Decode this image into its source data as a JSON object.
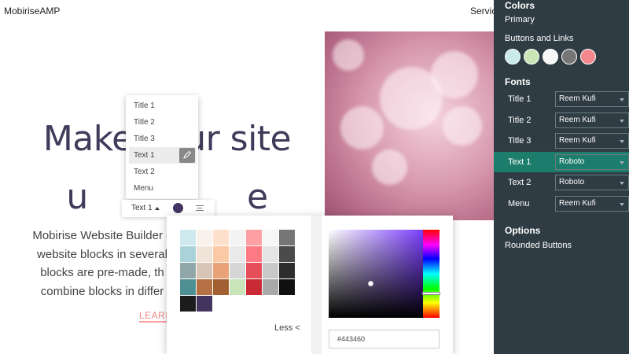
{
  "header": {
    "brand": "MobiriseAMP",
    "nav_partial": "Servic"
  },
  "hero": {
    "title_lines": [
      "Make your site",
      "u               e"
    ],
    "text_lines": [
      "Mobirise Website Builder c",
      "website blocks in several",
      "blocks are pre-made, th",
      "combine blocks in differ"
    ],
    "learn_button": "LEARN"
  },
  "style_menu": {
    "items": [
      "Title 1",
      "Title 2",
      "Title 3",
      "Text 1",
      "Text 2",
      "Menu"
    ],
    "active_index": 3
  },
  "text_toolbar": {
    "style_label": "Text 1",
    "color": "#443460"
  },
  "color_picker": {
    "swatches": [
      [
        "#cde9ee",
        "#f9f2ec",
        "#fde1cc",
        "#f4f4f4",
        "#ff9fa4",
        "#f6f6f6",
        "#767676"
      ],
      [
        "#a9d2d9",
        "#f0e3d8",
        "#fbc9a5",
        "#e9e9e9",
        "#ff7a82",
        "#e4e4e4",
        "#4b4b4b"
      ],
      [
        "#8fa7a8",
        "#d8c5b5",
        "#e9a278",
        "#d6d6d6",
        "#e64e59",
        "#c9c9c9",
        "#2d2d2d"
      ],
      [
        "#4e8f94",
        "#b57044",
        "#a25f31",
        "#c9e4b8",
        "#c92a35",
        "#a9a9a9",
        "#101010"
      ],
      [
        "#1c1c1c",
        "#443460"
      ]
    ],
    "less_label": "Less <",
    "hex_value": "#443460"
  },
  "panel": {
    "colors_heading": "Colors",
    "primary_label": "Primary",
    "buttons_links_label": "Buttons and Links",
    "color_circles": [
      "#c9e9ea",
      "#c9e5b5",
      "#f7f7f7",
      "#767676",
      "#f4888c"
    ],
    "fonts_heading": "Fonts",
    "font_rows": [
      {
        "name": "Title 1",
        "font": "Reem Kufi"
      },
      {
        "name": "Title 2",
        "font": "Reem Kufi"
      },
      {
        "name": "Title 3",
        "font": "Reem Kufi"
      },
      {
        "name": "Text 1",
        "font": "Roboto"
      },
      {
        "name": "Text 2",
        "font": "Roboto"
      },
      {
        "name": "Menu",
        "font": "Reem Kufi"
      }
    ],
    "active_font_row": 3,
    "options_heading": "Options",
    "rounded_buttons_label": "Rounded Buttons"
  }
}
